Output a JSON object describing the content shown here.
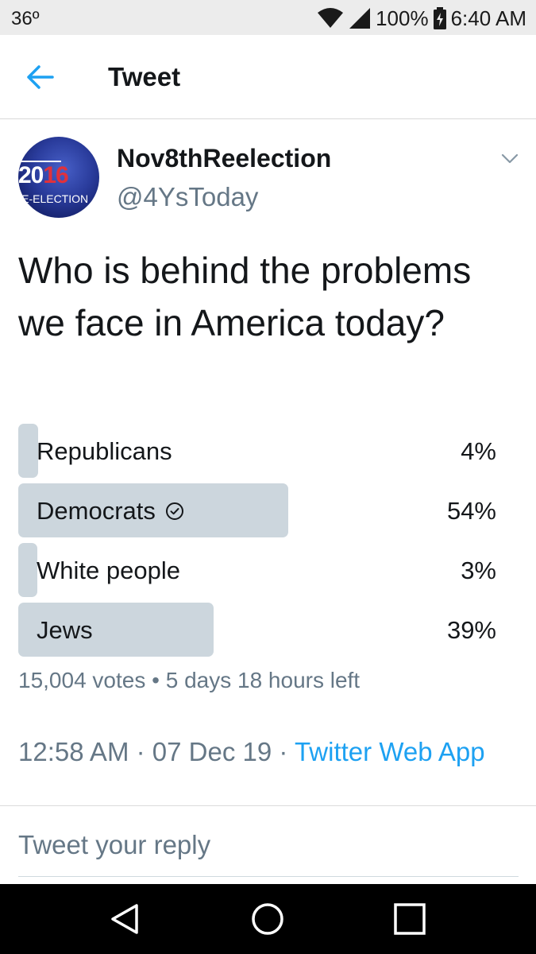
{
  "status_bar": {
    "temperature": "36º",
    "battery": "100%",
    "time": "6:40 AM"
  },
  "app_bar": {
    "title": "Tweet"
  },
  "author": {
    "display_name": "Nov8thReelection",
    "handle": "@4YsToday",
    "avatar_text": {
      "year_white": "20",
      "year_red": "16",
      "subtitle": "RE-ELECTION"
    }
  },
  "tweet": {
    "text": "Who is behind the problems we face in America today?"
  },
  "poll": {
    "options": [
      {
        "label": "Republicans",
        "percent_text": "4%",
        "percent": 4,
        "selected": false
      },
      {
        "label": "Democrats",
        "percent_text": "54%",
        "percent": 54,
        "selected": true
      },
      {
        "label": "White people",
        "percent_text": "3%",
        "percent": 3,
        "selected": false
      },
      {
        "label": "Jews",
        "percent_text": "39%",
        "percent": 39,
        "selected": false
      }
    ],
    "votes": "15,004 votes",
    "separator": "•",
    "time_left": "5 days 18 hours left"
  },
  "timestamp": {
    "time": "12:58 AM",
    "date": "07 Dec 19",
    "separator": "·",
    "source": "Twitter Web App"
  },
  "reply": {
    "placeholder": "Tweet your reply"
  },
  "colors": {
    "accent": "#1da1f2",
    "poll_bar": "#ccd6dd",
    "secondary_text": "#657786",
    "avatar_red": "#e0313c"
  },
  "icons": {
    "back": "arrow-left-icon",
    "caret": "chevron-down-icon",
    "selected": "check-circle-icon",
    "wifi": "wifi-icon",
    "signal": "signal-icon",
    "battery": "battery-charging-icon",
    "nav_back": "triangle-back-icon",
    "nav_home": "circle-home-icon",
    "nav_recents": "square-recents-icon"
  }
}
